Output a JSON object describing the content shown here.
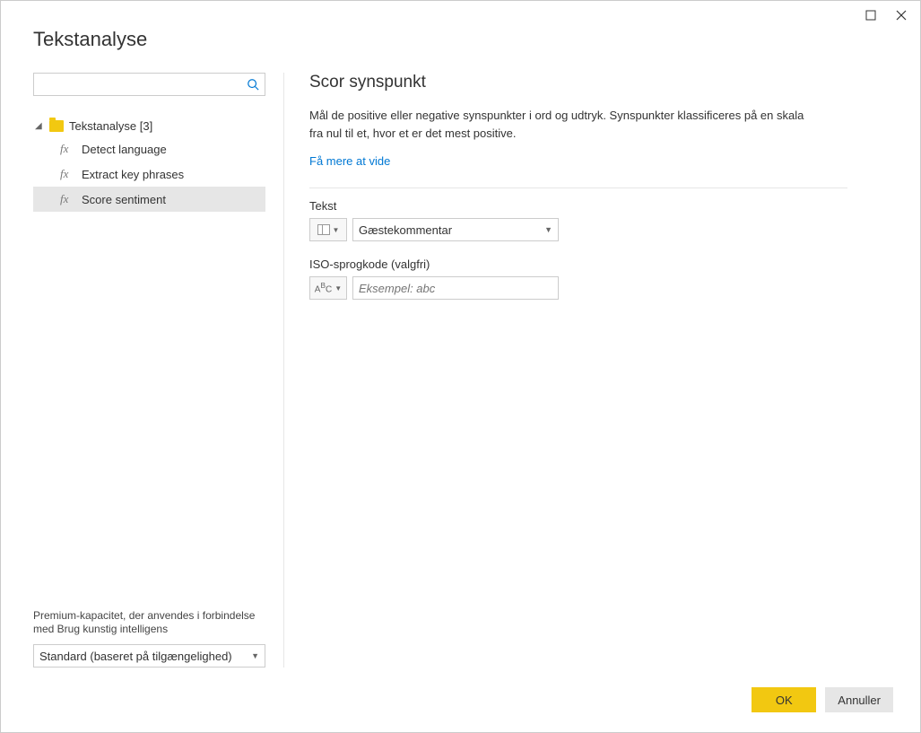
{
  "window": {
    "title": "Tekstanalyse"
  },
  "sidebar": {
    "search_placeholder": "",
    "folder_label": "Tekstanalyse [3]",
    "items": [
      {
        "label": "Detect language"
      },
      {
        "label": "Extract key phrases"
      },
      {
        "label": "Score sentiment"
      }
    ],
    "capacity_label": "Premium-kapacitet, der anvendes i forbindelse med Brug kunstig intelligens",
    "capacity_value": "Standard (baseret på tilgængelighed)"
  },
  "main": {
    "heading": "Scor synspunkt",
    "description": "Mål de positive eller negative synspunkter i ord og udtryk. Synspunkter klassificeres på en skala fra nul til et, hvor et er det mest positive.",
    "learn_more": "Få mere at vide",
    "fields": {
      "text_label": "Tekst",
      "text_value": "Gæstekommentar",
      "iso_label": "ISO-sprogkode (valgfri)",
      "iso_placeholder": "Eksempel: abc"
    }
  },
  "footer": {
    "ok": "OK",
    "cancel": "Annuller"
  }
}
